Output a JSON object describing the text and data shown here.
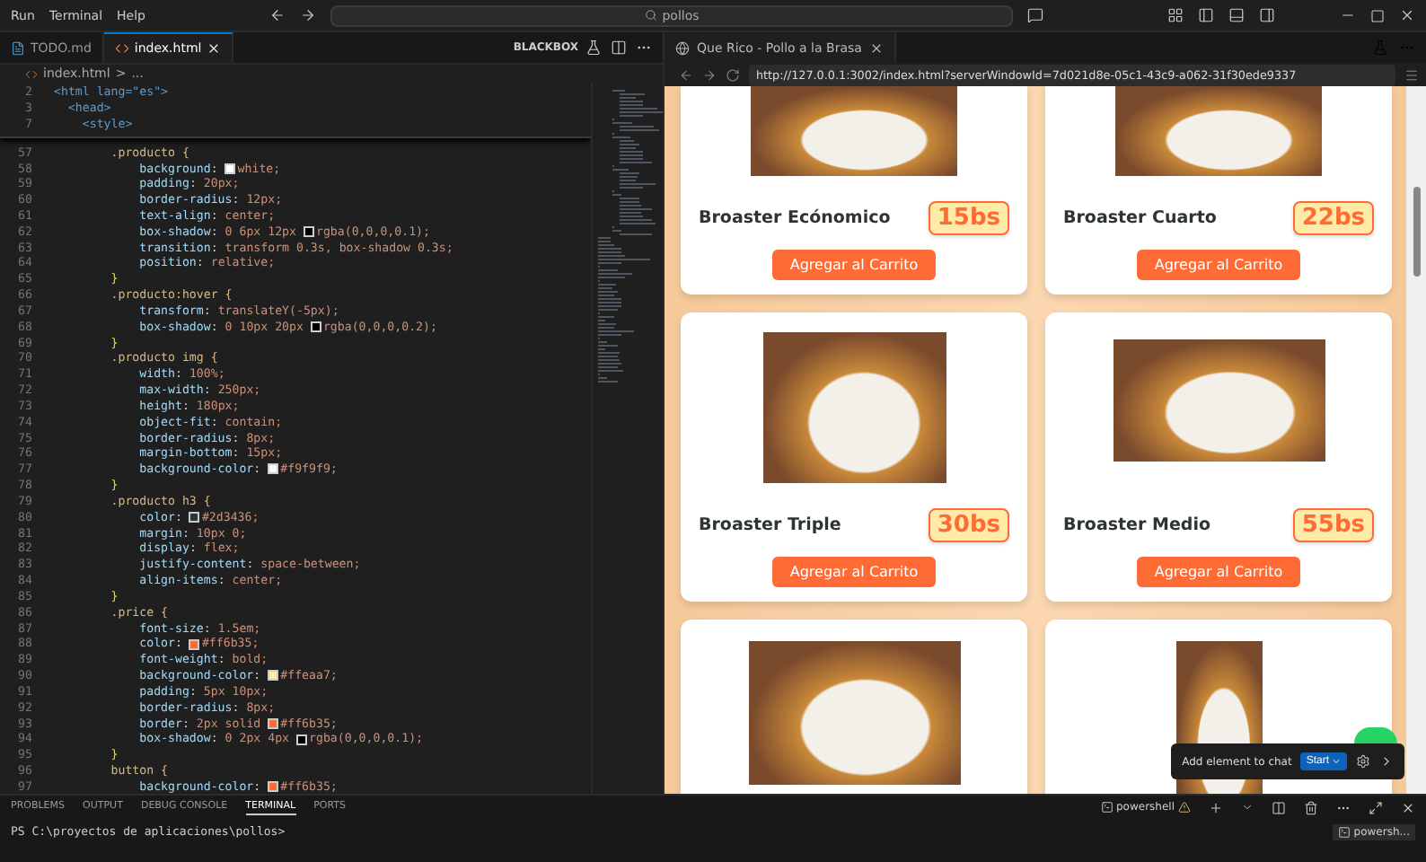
{
  "menu": [
    "Run",
    "Terminal",
    "Help"
  ],
  "search": {
    "value": "pollos"
  },
  "editor_tabs": [
    {
      "label": "TODO.md",
      "selected": false
    },
    {
      "label": "index.html",
      "selected": true
    }
  ],
  "blackbox_label": "BLACKBOX",
  "breadcrumb": [
    "index.html",
    ">",
    "..."
  ],
  "sticky_lines": [
    {
      "num": "2",
      "text": "<html lang=\"es\">"
    },
    {
      "num": "3",
      "text": "  <head>"
    },
    {
      "num": "7",
      "text": "    <style>"
    }
  ],
  "code_lines": [
    {
      "num": "57",
      "text": "        .producto {"
    },
    {
      "num": "58",
      "text": "            background: ",
      "color": "#ffffff",
      "tail": "white;"
    },
    {
      "num": "59",
      "text": "            padding: 20px;"
    },
    {
      "num": "60",
      "text": "            border-radius: 12px;"
    },
    {
      "num": "61",
      "text": "            text-align: center;"
    },
    {
      "num": "62",
      "text": "            box-shadow: 0 6px 12px ",
      "color": "#000000",
      "tail": "rgba(0,0,0,0.1);"
    },
    {
      "num": "63",
      "text": "            transition: transform 0.3s, box-shadow 0.3s;"
    },
    {
      "num": "64",
      "text": "            position: relative;"
    },
    {
      "num": "65",
      "text": "        }"
    },
    {
      "num": "66",
      "text": "        .producto:hover {"
    },
    {
      "num": "67",
      "text": "            transform: translateY(-5px);"
    },
    {
      "num": "68",
      "text": "            box-shadow: 0 10px 20px ",
      "color": "#000000",
      "tail": "rgba(0,0,0,0.2);"
    },
    {
      "num": "69",
      "text": "        }"
    },
    {
      "num": "70",
      "text": "        .producto img {"
    },
    {
      "num": "71",
      "text": "            width: 100%;"
    },
    {
      "num": "72",
      "text": "            max-width: 250px;"
    },
    {
      "num": "73",
      "text": "            height: 180px;"
    },
    {
      "num": "74",
      "text": "            object-fit: contain;"
    },
    {
      "num": "75",
      "text": "            border-radius: 8px;"
    },
    {
      "num": "76",
      "text": "            margin-bottom: 15px;"
    },
    {
      "num": "77",
      "text": "            background-color: ",
      "color": "#f9f9f9",
      "tail": "#f9f9f9;"
    },
    {
      "num": "78",
      "text": "        }"
    },
    {
      "num": "79",
      "text": "        .producto h3 {"
    },
    {
      "num": "80",
      "text": "            color: ",
      "color": "#2d3436",
      "tail": "#2d3436;"
    },
    {
      "num": "81",
      "text": "            margin: 10px 0;"
    },
    {
      "num": "82",
      "text": "            display: flex;"
    },
    {
      "num": "83",
      "text": "            justify-content: space-between;"
    },
    {
      "num": "84",
      "text": "            align-items: center;"
    },
    {
      "num": "85",
      "text": "        }"
    },
    {
      "num": "86",
      "text": "        .price {"
    },
    {
      "num": "87",
      "text": "            font-size: 1.5em;"
    },
    {
      "num": "88",
      "text": "            color: ",
      "color": "#ff6b35",
      "tail": "#ff6b35;"
    },
    {
      "num": "89",
      "text": "            font-weight: bold;"
    },
    {
      "num": "90",
      "text": "            background-color: ",
      "color": "#ffeaa7",
      "tail": "#ffeaa7;"
    },
    {
      "num": "91",
      "text": "            padding: 5px 10px;"
    },
    {
      "num": "92",
      "text": "            border-radius: 8px;"
    },
    {
      "num": "93",
      "text": "            border: 2px solid ",
      "color": "#ff6b35",
      "tail": "#ff6b35;"
    },
    {
      "num": "94",
      "text": "            box-shadow: 0 2px 4px ",
      "color": "#000000",
      "tail": "rgba(0,0,0,0.1);"
    },
    {
      "num": "95",
      "text": "        }"
    },
    {
      "num": "96",
      "text": "        button {"
    },
    {
      "num": "97",
      "text": "            background-color: ",
      "color": "#ff6b35",
      "tail": "#ff6b35;"
    }
  ],
  "browser": {
    "tab": "Que Rico - Pollo a la Brasa",
    "url": "http://127.0.0.1:3002/index.html?serverWindowId=7d021d8e-05c1-43c9-a062-31f30ede9337"
  },
  "products": [
    {
      "kind": "top-cut",
      "name": "Broaster Ecónomico",
      "price": "15bs",
      "button": "Agregar al Carrito"
    },
    {
      "kind": "top-cut",
      "name": "Broaster Cuarto",
      "price": "22bs",
      "button": "Agregar al Carrito"
    },
    {
      "kind": "full",
      "name": "Broaster Triple",
      "price": "30bs",
      "button": "Agregar al Carrito"
    },
    {
      "kind": "full",
      "name": "Broaster Medio",
      "price": "55bs",
      "button": "Agregar al Carrito"
    },
    {
      "kind": "bottom-cut"
    },
    {
      "kind": "bottom-cut"
    }
  ],
  "chat_overlay": {
    "label": "Add element to chat",
    "button": "Start"
  },
  "panel_tabs": [
    {
      "label": "PROBLEMS",
      "selected": false
    },
    {
      "label": "OUTPUT",
      "selected": false
    },
    {
      "label": "DEBUG CONSOLE",
      "selected": false
    },
    {
      "label": "TERMINAL",
      "selected": true
    },
    {
      "label": "PORTS",
      "selected": false
    }
  ],
  "terminal": {
    "shell": "powershell",
    "prompt": "PS C:\\proyectos de aplicaciones\\pollos>",
    "list_item": "powersh..."
  }
}
